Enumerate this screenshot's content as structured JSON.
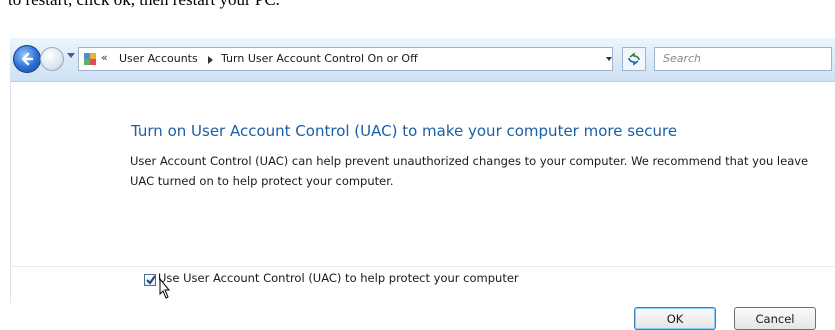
{
  "caption": "to restart, click ok, then restart your PC.",
  "nav": {
    "breadcrumb_prefix": "«",
    "breadcrumb": [
      "User Accounts",
      "Turn User Account Control On or Off"
    ]
  },
  "search": {
    "placeholder": "Search"
  },
  "content": {
    "heading": "Turn on User Account Control (UAC) to make your computer more secure",
    "description": "User Account Control (UAC) can help prevent unauthorized changes to your computer.  We recommend that you leave UAC turned on to help protect your computer.",
    "checkbox": {
      "label": "Use User Account Control (UAC) to help protect your computer",
      "checked": true
    }
  },
  "buttons": {
    "ok": "OK",
    "cancel": "Cancel"
  },
  "colors": {
    "heading": "#1a5fa6",
    "titlebar": "#d8e8f6"
  }
}
